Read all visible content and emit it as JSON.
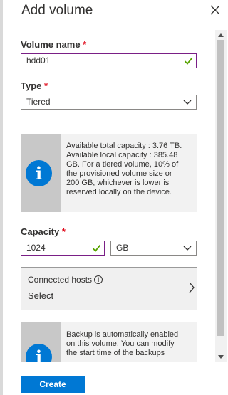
{
  "panel": {
    "title": "Add volume",
    "close_icon": "close-icon"
  },
  "volume_name": {
    "label": "Volume name",
    "required_mark": "*",
    "value": "hdd01",
    "valid_icon": "checkmark-icon"
  },
  "type": {
    "label": "Type",
    "required_mark": "*",
    "selected": "Tiered"
  },
  "capacity_info": {
    "lines": [
      "Available total capacity : 3.76 TB.",
      "Available local capacity : 385.48",
      "GB. For a tiered volume, 10% of",
      "the provisioned volume size or",
      "200 GB, whichever is lower is",
      "reserved locally on the device."
    ]
  },
  "capacity": {
    "label": "Capacity",
    "required_mark": "*",
    "value": "1024",
    "unit": "GB"
  },
  "connected_hosts": {
    "label": "Connected hosts",
    "value": "Select"
  },
  "backup_info": {
    "lines": [
      "Backup is automatically enabled",
      "on this volume. You can modify",
      "the start time of the backups"
    ]
  },
  "footer": {
    "create_label": "Create"
  },
  "colors": {
    "accent": "#0078d4",
    "required": "#e00b1c",
    "valid": "#57a300",
    "focus_border": "#7a1f86"
  }
}
